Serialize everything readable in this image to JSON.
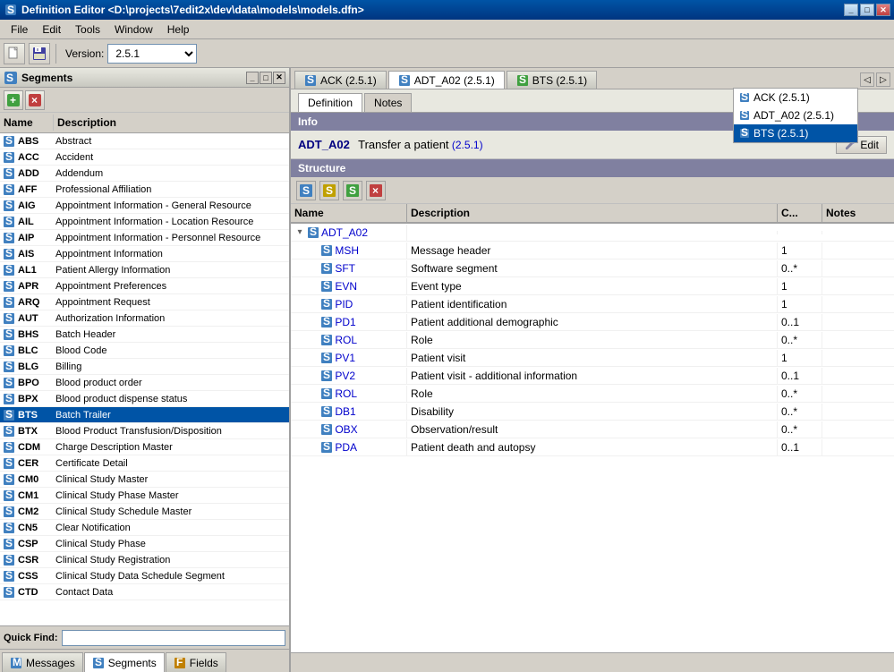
{
  "window": {
    "title": "Definition Editor <D:\\projects\\7edit2x\\dev\\data\\models\\models.dfn>",
    "icon": "S"
  },
  "menu": {
    "items": [
      "File",
      "Edit",
      "Tools",
      "Window",
      "Help"
    ]
  },
  "toolbar": {
    "version_label": "Version:",
    "version_value": "2.5.1"
  },
  "left_panel": {
    "title": "Segments",
    "columns": {
      "name": "Name",
      "description": "Description"
    },
    "segments": [
      {
        "name": "ABS",
        "desc": "Abstract"
      },
      {
        "name": "ACC",
        "desc": "Accident"
      },
      {
        "name": "ADD",
        "desc": "Addendum"
      },
      {
        "name": "AFF",
        "desc": "Professional Affiliation"
      },
      {
        "name": "AIG",
        "desc": "Appointment Information - General Resource"
      },
      {
        "name": "AIL",
        "desc": "Appointment Information - Location Resource"
      },
      {
        "name": "AIP",
        "desc": "Appointment Information - Personnel Resource"
      },
      {
        "name": "AIS",
        "desc": "Appointment Information"
      },
      {
        "name": "AL1",
        "desc": "Patient Allergy Information"
      },
      {
        "name": "APR",
        "desc": "Appointment Preferences"
      },
      {
        "name": "ARQ",
        "desc": "Appointment Request"
      },
      {
        "name": "AUT",
        "desc": "Authorization Information"
      },
      {
        "name": "BHS",
        "desc": "Batch Header"
      },
      {
        "name": "BLC",
        "desc": "Blood Code"
      },
      {
        "name": "BLG",
        "desc": "Billing"
      },
      {
        "name": "BPO",
        "desc": "Blood product order"
      },
      {
        "name": "BPX",
        "desc": "Blood product dispense status"
      },
      {
        "name": "BTS",
        "desc": "Batch Trailer",
        "selected": true
      },
      {
        "name": "BTX",
        "desc": "Blood Product Transfusion/Disposition"
      },
      {
        "name": "CDM",
        "desc": "Charge Description Master"
      },
      {
        "name": "CER",
        "desc": "Certificate Detail"
      },
      {
        "name": "CM0",
        "desc": "Clinical Study Master"
      },
      {
        "name": "CM1",
        "desc": "Clinical Study Phase Master"
      },
      {
        "name": "CM2",
        "desc": "Clinical Study Schedule Master"
      },
      {
        "name": "CN5",
        "desc": "Clear Notification"
      },
      {
        "name": "CSP",
        "desc": "Clinical Study Phase"
      },
      {
        "name": "CSR",
        "desc": "Clinical Study Registration"
      },
      {
        "name": "CSS",
        "desc": "Clinical Study Data Schedule Segment"
      },
      {
        "name": "CTD",
        "desc": "Contact Data"
      }
    ],
    "quick_find_label": "Quick Find:",
    "quick_find_placeholder": ""
  },
  "bottom_tabs": [
    {
      "label": "Messages",
      "active": false
    },
    {
      "label": "Segments",
      "active": true
    },
    {
      "label": "Fields",
      "active": false
    }
  ],
  "tabs": [
    {
      "label": "ACK (2.5.1)",
      "color": "blue"
    },
    {
      "label": "ADT_A02 (2.5.1)",
      "color": "blue",
      "active": true
    },
    {
      "label": "BTS (2.5.1)",
      "color": "green"
    }
  ],
  "tab_dropdown": [
    {
      "label": "ACK (2.5.1)"
    },
    {
      "label": "ADT_A02 (2.5.1)"
    },
    {
      "label": "BTS (2.5.1)",
      "selected": true
    }
  ],
  "content_tabs": [
    {
      "label": "Definition",
      "active": true
    },
    {
      "label": "Notes"
    }
  ],
  "info": {
    "label": "Info",
    "name": "ADT_A02",
    "description": "Transfer a patient",
    "version": "(2.5.1)",
    "edit_label": "Edit"
  },
  "structure": {
    "label": "Structure",
    "columns": {
      "name": "Name",
      "description": "Description",
      "c": "C...",
      "notes": "Notes"
    },
    "root": "ADT_A02",
    "rows": [
      {
        "name": "MSH",
        "indent": 1,
        "desc": "Message header",
        "c": "1",
        "notes": ""
      },
      {
        "name": "SFT",
        "indent": 1,
        "desc": "Software segment",
        "c": "0..*",
        "notes": ""
      },
      {
        "name": "EVN",
        "indent": 1,
        "desc": "Event type",
        "c": "1",
        "notes": ""
      },
      {
        "name": "PID",
        "indent": 1,
        "desc": "Patient identification",
        "c": "1",
        "notes": ""
      },
      {
        "name": "PD1",
        "indent": 1,
        "desc": "Patient additional demographic",
        "c": "0..1",
        "notes": ""
      },
      {
        "name": "ROL",
        "indent": 1,
        "desc": "Role",
        "c": "0..*",
        "notes": ""
      },
      {
        "name": "PV1",
        "indent": 1,
        "desc": "Patient visit",
        "c": "1",
        "notes": ""
      },
      {
        "name": "PV2",
        "indent": 1,
        "desc": "Patient visit - additional information",
        "c": "0..1",
        "notes": ""
      },
      {
        "name": "ROL",
        "indent": 1,
        "desc": "Role",
        "c": "0..*",
        "notes": ""
      },
      {
        "name": "DB1",
        "indent": 1,
        "desc": "Disability",
        "c": "0..*",
        "notes": ""
      },
      {
        "name": "OBX",
        "indent": 1,
        "desc": "Observation/result",
        "c": "0..*",
        "notes": ""
      },
      {
        "name": "PDA",
        "indent": 1,
        "desc": "Patient death and autopsy",
        "c": "0..1",
        "notes": ""
      }
    ]
  },
  "icons": {
    "s_blue": "S",
    "s_green": "S",
    "s_yellow": "S",
    "add": "+",
    "delete": "×",
    "edit_pencil": "✎",
    "expand_tree": "▸",
    "collapse_tree": "▾",
    "arrow_left": "◀",
    "arrow_right": "▶",
    "nav_prev": "◁",
    "nav_next": "▷"
  }
}
